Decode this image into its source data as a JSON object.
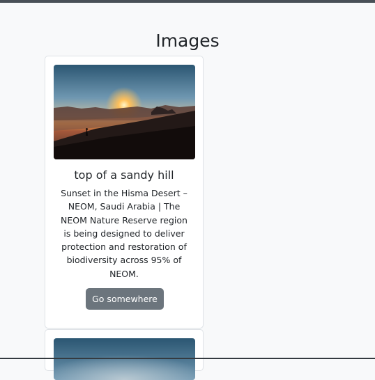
{
  "page": {
    "title": "Images"
  },
  "cards": [
    {
      "title": "top of a sandy hill",
      "text": "Sunset in the Hisma Desert – NEOM, Saudi Arabia | The NEOM Nature Reserve region is being designed to deliver protection and restoration of biodiversity across 95% of NEOM.",
      "button_label": "Go somewhere",
      "image_alt": "desert sunset photo"
    },
    {
      "image_alt": "desert sunset photo"
    }
  ],
  "colors": {
    "background": "#f8f9fa",
    "card_border": "#dee2e6",
    "button": "#6c757d",
    "button_text": "#ffffff"
  }
}
